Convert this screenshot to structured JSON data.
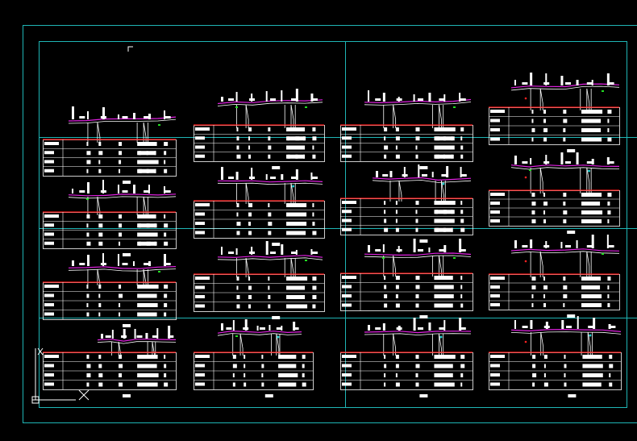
{
  "app": {
    "view": "model-space",
    "background_color": "#000000"
  },
  "colors": {
    "frame": "#1fb5b5",
    "table_header": "#ff1a1a",
    "table_lines": "#ffffff",
    "profile_top": "#e020e0",
    "profile_ground": "#ffffff",
    "pipes": "#ffffff",
    "green_marks": "#22dd22",
    "cyan_marks": "#22cccc",
    "red_marks": "#ff2222"
  },
  "drawing": {
    "sheet_count": 15,
    "icons": [
      "ucs-icon",
      "crosshair-cursor-icon",
      "corner-mark-icon"
    ]
  }
}
